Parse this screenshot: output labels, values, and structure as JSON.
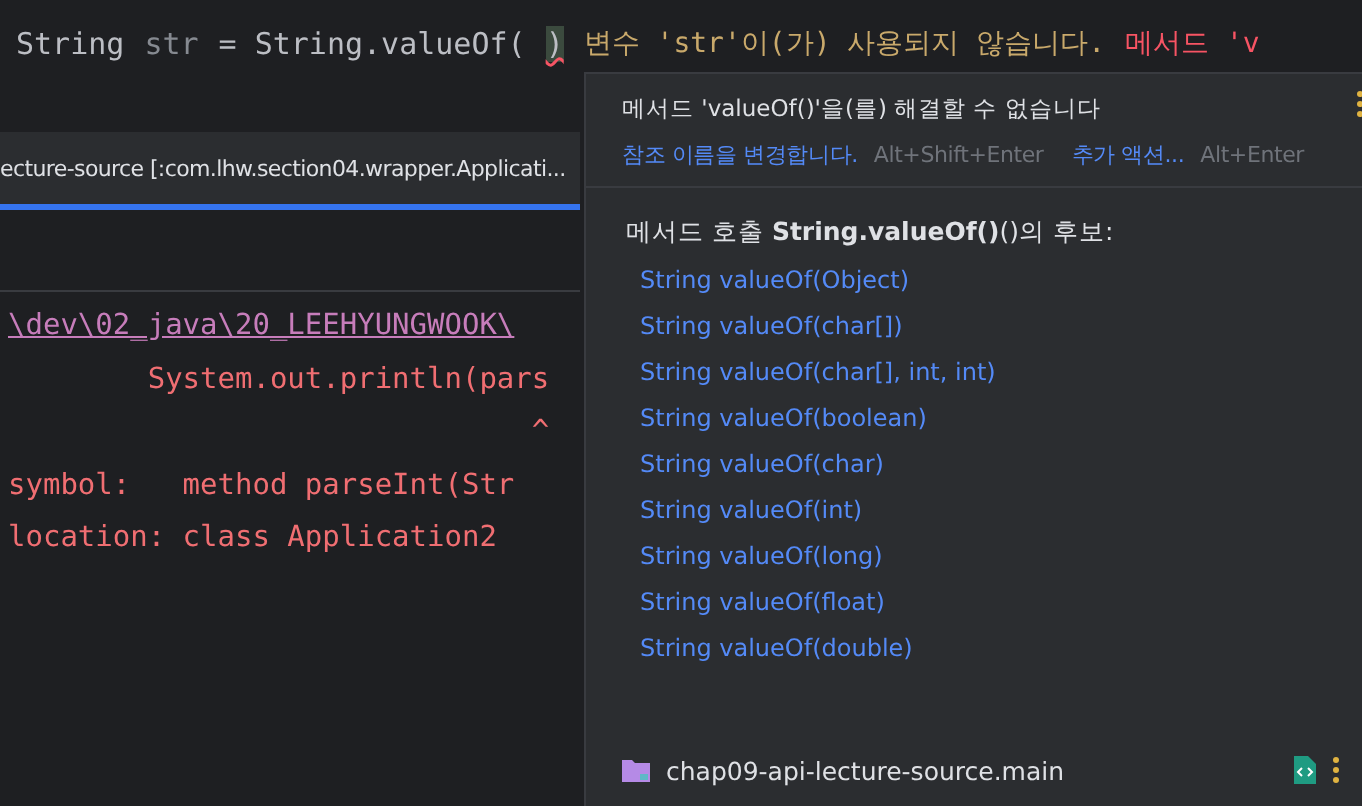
{
  "editor_line": {
    "code_parts": [
      {
        "kind": "type",
        "text": "String"
      },
      {
        "kind": "unused",
        "text": "str"
      },
      {
        "kind": "plain",
        "text": "= String.valueOf("
      },
      {
        "kind": "error",
        "text": ")"
      }
    ],
    "inlay_hints": [
      {
        "kind": "warning",
        "text": "변수 'str'이(가) 사용되지 않습니다."
      },
      {
        "kind": "error",
        "text": "메서드 'v"
      }
    ]
  },
  "run_tab": {
    "title": "ecture-source [:com.lhw.section04.wrapper.Applicati..."
  },
  "console": [
    {
      "kind": "link",
      "text": "\\dev\\02_java\\20_LEEHYUNGWOOK\\"
    },
    {
      "kind": "error",
      "text": "        System.out.println(pars"
    },
    {
      "kind": "error",
      "text": "                              ^"
    },
    {
      "kind": "error",
      "text": "symbol:   method parseInt(Str"
    },
    {
      "kind": "error",
      "text": "location: class Application2"
    }
  ],
  "popup": {
    "message": "메서드 'valueOf()'을(를) 해결할 수 없습니다",
    "actions": [
      {
        "label": "참조 이름을 변경합니다.",
        "shortcut": "Alt+Shift+Enter"
      },
      {
        "label": "추가 액션...",
        "shortcut": "Alt+Enter"
      }
    ],
    "candidates_title": "메서드 호출 **String.valueOf()**()의 후보:",
    "candidates": [
      "String valueOf(Object)",
      "String valueOf(char[])",
      "String valueOf(char[], int, int)",
      "String valueOf(boolean)",
      "String valueOf(char)",
      "String valueOf(int)",
      "String valueOf(long)",
      "String valueOf(float)",
      "String valueOf(double)"
    ],
    "module": "chap09-api-lecture-source.main"
  }
}
